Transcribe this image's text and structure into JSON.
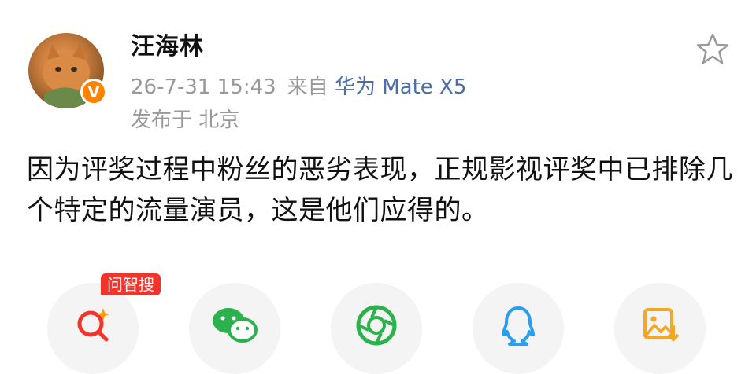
{
  "user": {
    "name": "汪海林",
    "verified_badge": "V"
  },
  "post": {
    "time": "26-7-31 15:43",
    "source_prefix": "来自",
    "device": "华为 Mate X5",
    "location": "发布于 北京",
    "text": "因为评奖过程中粉丝的恶劣表现，正规影视评奖中已排除几个特定的流量演员，这是他们应得的。"
  },
  "share": {
    "tag": "问智搜",
    "buttons": [
      {
        "icon": "search-ai-icon"
      },
      {
        "icon": "wechat-icon"
      },
      {
        "icon": "moments-icon"
      },
      {
        "icon": "qq-icon"
      },
      {
        "icon": "save-image-icon"
      }
    ]
  },
  "colors": {
    "accent_orange": "#ff8200",
    "device_blue": "#4a6fa8",
    "tag_red": "#f2342c"
  }
}
